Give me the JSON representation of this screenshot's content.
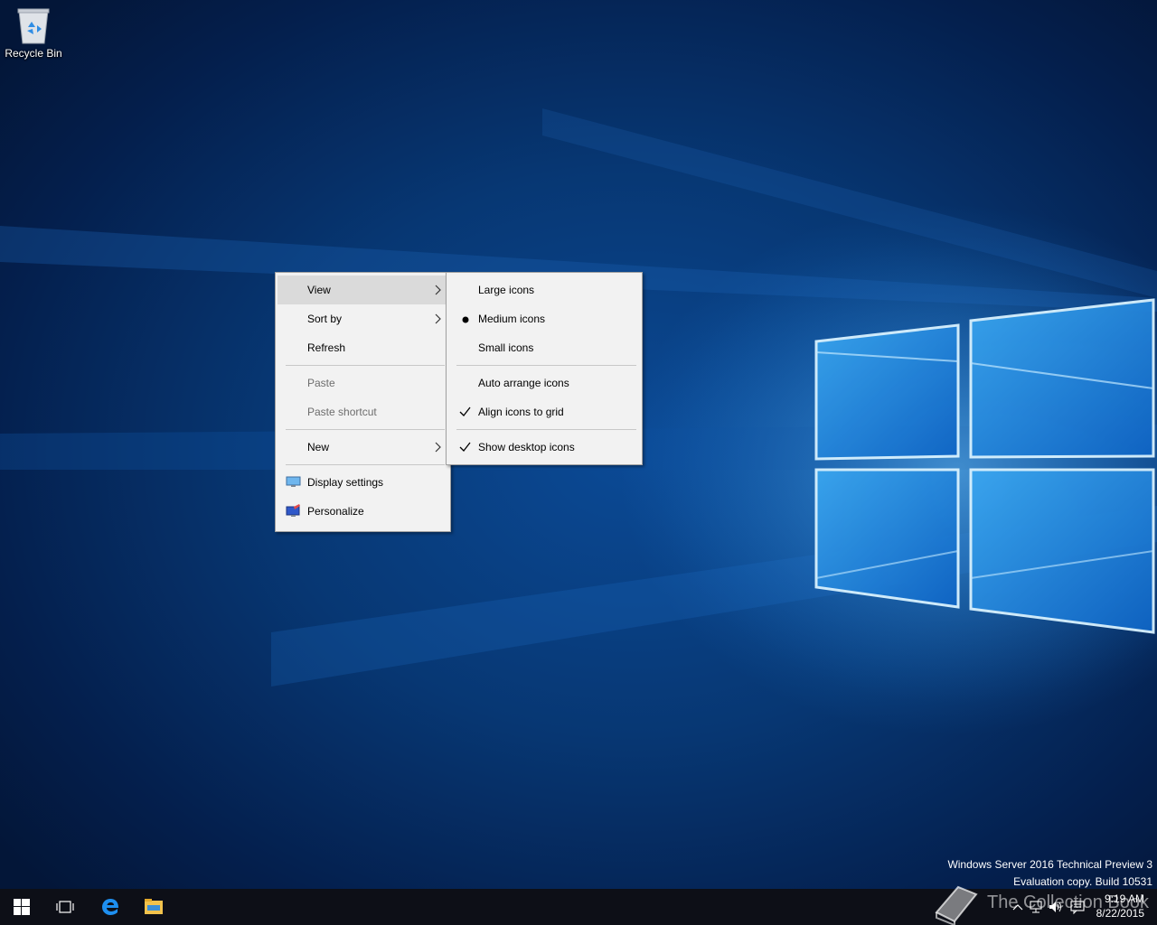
{
  "desktop": {
    "recycle_bin_label": "Recycle Bin"
  },
  "context_menu": {
    "items": [
      {
        "label": "View",
        "state": "highlighted",
        "submenu": true
      },
      {
        "label": "Sort by",
        "submenu": true
      },
      {
        "label": "Refresh"
      },
      {
        "label": "Paste",
        "disabled": true
      },
      {
        "label": "Paste shortcut",
        "disabled": true
      },
      {
        "label": "New",
        "submenu": true
      },
      {
        "label": "Display settings",
        "icon": "display-icon"
      },
      {
        "label": "Personalize",
        "icon": "personalize-icon"
      }
    ]
  },
  "view_submenu": {
    "items": [
      {
        "label": "Large icons"
      },
      {
        "label": "Medium icons",
        "selected": "radio-dot"
      },
      {
        "label": "Small icons"
      },
      {
        "label": "Auto arrange icons"
      },
      {
        "label": "Align icons to grid",
        "checked": true
      },
      {
        "label": "Show desktop icons",
        "checked": true
      }
    ]
  },
  "watermark": {
    "line1": "Windows Server 2016 Technical Preview 3",
    "line2": "Evaluation copy. Build 10531"
  },
  "taskbar": {
    "buttons": [
      "start-icon",
      "task-view-icon",
      "edge-icon",
      "file-explorer-icon"
    ],
    "tray_icons": [
      "chevron-up-icon",
      "network-icon",
      "volume-icon",
      "action-center-icon"
    ],
    "clock_time": "9:19 AM",
    "clock_date": "8/22/2015"
  },
  "overlay_logo": {
    "text": "The Collection Book",
    "icon": "book-icon"
  },
  "colors": {
    "menu_bg": "#f2f2f2",
    "menu_highlight": "#dadada",
    "taskbar_bg": "#0d0f17",
    "wallpaper_blue": "#0b4a96"
  }
}
